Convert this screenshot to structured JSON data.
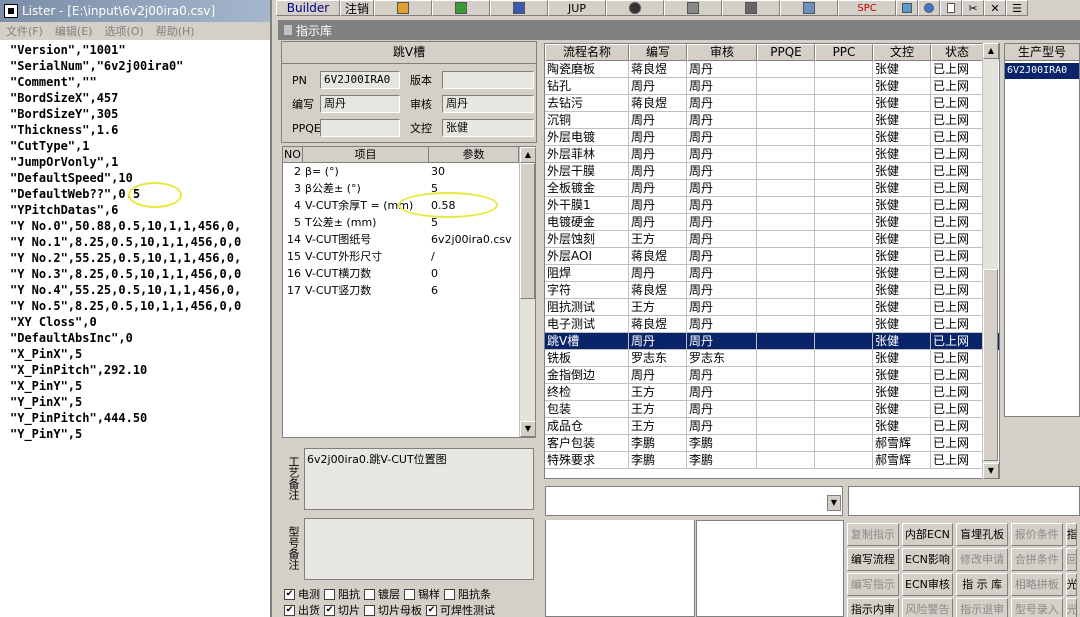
{
  "lister": {
    "title": "Lister - [E:\\input\\6v2j00ira0.csv]",
    "menu": [
      "文件(F)",
      "编辑(E)",
      "选项(O)",
      "帮助(H)"
    ],
    "lines": [
      "\"Version\",\"1001\"",
      "\"SerialNum\",\"6v2j00ira0\"",
      "\"Comment\",\"\"",
      "\"BordSizeX\",457",
      "\"BordSizeY\",305",
      "\"Thickness\",1.6",
      "\"CutType\",1",
      "\"JumpOrVonly\",1",
      "\"DefaultSpeed\",10",
      "\"DefaultWeb??\",0.5",
      "\"YPitchDatas\",6",
      "\"Y No.0\",50.88,0.5,10,1,1,456,0,",
      "\"Y No.1\",8.25,0.5,10,1,1,456,0,0",
      "\"Y No.2\",55.25,0.5,10,1,1,456,0,",
      "\"Y No.3\",8.25,0.5,10,1,1,456,0,0",
      "\"Y No.4\",55.25,0.5,10,1,1,456,0,",
      "\"Y No.5\",8.25,0.5,10,1,1,456,0,0",
      "\"XY Closs\",0",
      "\"DefaultAbsInc\",0",
      "\"X_PinX\",5",
      "\"X_PinPitch\",292.10",
      "\"X_PinY\",5",
      "\"Y_PinX\",5",
      "\"Y_PinPitch\",444.50",
      "\"Y_PinY\",5"
    ]
  },
  "toolbar": {
    "builder": "Builder",
    "logout": "注销",
    "jup": "JUP",
    "spc": "SPC"
  },
  "dialog": {
    "title": "指示库"
  },
  "form": {
    "header": "跳V槽",
    "pn_label": "PN",
    "pn_value": "6V2J00IRA0",
    "version_label": "版本",
    "version_value": "",
    "author_label": "编写",
    "author_value": "周丹",
    "review_label": "审核",
    "review_value": "周丹",
    "ppqe_label": "PPQE",
    "ppqe_value": "",
    "doc_label": "文控",
    "doc_value": "张健"
  },
  "params": {
    "headers": [
      "NO",
      "项目",
      "参数"
    ],
    "rows": [
      {
        "no": "2",
        "name": "β= (°)",
        "val": "30"
      },
      {
        "no": "3",
        "name": "β公差± (°)",
        "val": "5"
      },
      {
        "no": "4",
        "name": "V-CUT余厚T = (mm)",
        "val": "0.58"
      },
      {
        "no": "5",
        "name": "T公差± (mm)",
        "val": "5"
      },
      {
        "no": "14",
        "name": "V-CUT图纸号",
        "val": "6v2j00ira0.csv"
      },
      {
        "no": "15",
        "name": "V-CUT外形尺寸",
        "val": "/"
      },
      {
        "no": "16",
        "name": "V-CUT横刀数",
        "val": "0"
      },
      {
        "no": "17",
        "name": "V-CUT竖刀数",
        "val": "6"
      }
    ]
  },
  "notes": {
    "process_label": "工艺备注",
    "process_text": "6v2j00ira0.跳V-CUT位置图",
    "model_label": "型号备注",
    "model_text": ""
  },
  "checks": {
    "row1": [
      {
        "label": "电测",
        "checked": true
      },
      {
        "label": "阻抗",
        "checked": false
      },
      {
        "label": "镀层",
        "checked": false
      },
      {
        "label": "锡样",
        "checked": false
      },
      {
        "label": "阻抗条",
        "checked": false
      }
    ],
    "row2": [
      {
        "label": "出货",
        "checked": true
      },
      {
        "label": "切片",
        "checked": true
      },
      {
        "label": "切片母板",
        "checked": false
      },
      {
        "label": "可焊性测试",
        "checked": true
      }
    ]
  },
  "process": {
    "headers": [
      "流程名称",
      "编写",
      "审核",
      "PPQE",
      "PPC",
      "文控",
      "状态"
    ],
    "rows": [
      [
        "陶瓷磨板",
        "蒋良煜",
        "周丹",
        "",
        "",
        "张健",
        "已上网"
      ],
      [
        "钻孔",
        "周丹",
        "周丹",
        "",
        "",
        "张健",
        "已上网"
      ],
      [
        "去钻污",
        "蒋良煜",
        "周丹",
        "",
        "",
        "张健",
        "已上网"
      ],
      [
        "沉铜",
        "周丹",
        "周丹",
        "",
        "",
        "张健",
        "已上网"
      ],
      [
        "外层电镀",
        "周丹",
        "周丹",
        "",
        "",
        "张健",
        "已上网"
      ],
      [
        "外层菲林",
        "周丹",
        "周丹",
        "",
        "",
        "张健",
        "已上网"
      ],
      [
        "外层干膜",
        "周丹",
        "周丹",
        "",
        "",
        "张健",
        "已上网"
      ],
      [
        "全板镀金",
        "周丹",
        "周丹",
        "",
        "",
        "张健",
        "已上网"
      ],
      [
        "外干膜1",
        "周丹",
        "周丹",
        "",
        "",
        "张健",
        "已上网"
      ],
      [
        "电镀硬金",
        "周丹",
        "周丹",
        "",
        "",
        "张健",
        "已上网"
      ],
      [
        "外层蚀刻",
        "王方",
        "周丹",
        "",
        "",
        "张健",
        "已上网"
      ],
      [
        "外层AOI",
        "蒋良煜",
        "周丹",
        "",
        "",
        "张健",
        "已上网"
      ],
      [
        "阻焊",
        "周丹",
        "周丹",
        "",
        "",
        "张健",
        "已上网"
      ],
      [
        "字符",
        "蒋良煜",
        "周丹",
        "",
        "",
        "张健",
        "已上网"
      ],
      [
        "阻抗测试",
        "王方",
        "周丹",
        "",
        "",
        "张健",
        "已上网"
      ],
      [
        "电子测试",
        "蒋良煜",
        "周丹",
        "",
        "",
        "张健",
        "已上网"
      ],
      [
        "跳V槽",
        "周丹",
        "周丹",
        "",
        "",
        "张健",
        "已上网"
      ],
      [
        "铣板",
        "罗志东",
        "罗志东",
        "",
        "",
        "张健",
        "已上网"
      ],
      [
        "金指倒边",
        "周丹",
        "周丹",
        "",
        "",
        "张健",
        "已上网"
      ],
      [
        "终检",
        "王方",
        "周丹",
        "",
        "",
        "张健",
        "已上网"
      ],
      [
        "包装",
        "王方",
        "周丹",
        "",
        "",
        "张健",
        "已上网"
      ],
      [
        "成品仓",
        "王方",
        "周丹",
        "",
        "",
        "张健",
        "已上网"
      ],
      [
        "客户包装",
        "李鹏",
        "李鹏",
        "",
        "",
        "郝雪辉",
        "已上网"
      ],
      [
        "特殊要求",
        "李鹏",
        "李鹏",
        "",
        "",
        "郝雪辉",
        "已上网"
      ]
    ],
    "selected_index": 16
  },
  "model": {
    "header": "生产型号",
    "item": "6V2J00IRA0"
  },
  "buttons": {
    "row1": [
      {
        "label": "复制指示",
        "enabled": false
      },
      {
        "label": "内部ECN",
        "enabled": true
      },
      {
        "label": "盲埋孔板",
        "enabled": true
      },
      {
        "label": "报价条件",
        "enabled": false
      },
      {
        "label": "指",
        "enabled": true
      }
    ],
    "row2": [
      {
        "label": "编写流程",
        "enabled": true
      },
      {
        "label": "ECN影响",
        "enabled": true
      },
      {
        "label": "修改申请",
        "enabled": false
      },
      {
        "label": "合拼条件",
        "enabled": false
      },
      {
        "label": "回",
        "enabled": false
      }
    ],
    "row3": [
      {
        "label": "编写指示",
        "enabled": false
      },
      {
        "label": "ECN审核",
        "enabled": true
      },
      {
        "label": "指 示 库",
        "enabled": true
      },
      {
        "label": "相略拼板",
        "enabled": false
      },
      {
        "label": "光",
        "enabled": true
      }
    ],
    "row4": [
      {
        "label": "指示内审",
        "enabled": true
      },
      {
        "label": "风险警告",
        "enabled": false
      },
      {
        "label": "指示退审",
        "enabled": false
      },
      {
        "label": "型号录入",
        "enabled": false
      },
      {
        "label": "光",
        "enabled": false
      }
    ]
  },
  "colors": {
    "selection": "#0a246a",
    "highlight_circle": "#e8e840"
  }
}
